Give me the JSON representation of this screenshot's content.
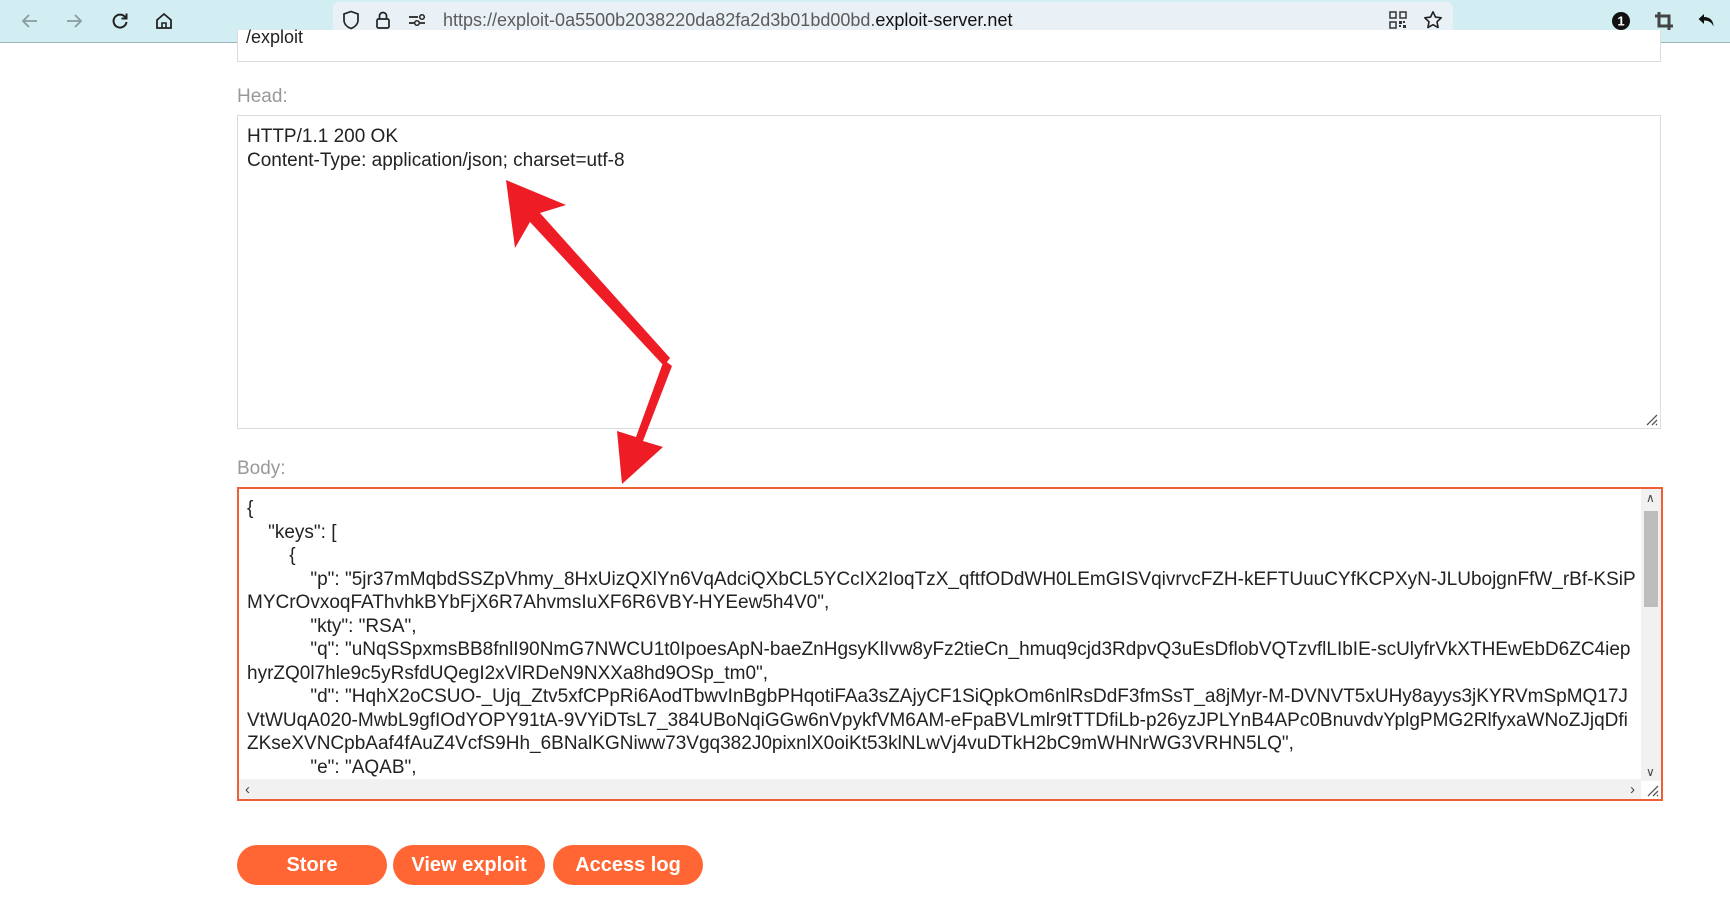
{
  "browser": {
    "url_prefix": "https://exploit-0a5500b2038220da82fa2d3b01bd00bd.",
    "url_domain": "exploit-server.net",
    "extension_badge": "1"
  },
  "form": {
    "file_value": "/exploit",
    "head_label": "Head:",
    "head_value": "HTTP/1.1 200 OK\nContent-Type: application/json; charset=utf-8",
    "body_label": "Body:",
    "body_value": "{\n    \"keys\": [\n        {\n            \"p\": \"5jr37mMqbdSSZpVhmy_8HxUizQXlYn6VqAdciQXbCL5YCcIX2IoqTzX_qftfODdWH0LEmGISVqivrvcFZH-kEFTUuuCYfKCPXyN-JLUbojgnFfW_rBf-KSiPMYCrOvxoqFAThvhkBYbFjX6R7AhvmsIuXF6R6VBY-HYEew5h4V0\",\n            \"kty\": \"RSA\",\n            \"q\": \"uNqSSpxmsBB8fnlI90NmG7NWCU1t0IpoesApN-baeZnHgsyKlIvw8yFz2tieCn_hmuq9cjd3RdpvQ3uEsDflobVQTzvflLIbIE-scUlyfrVkXTHEwEbD6ZC4iephyrZQ0l7hle9c5yRsfdUQegI2xVlRDeN9NXXa8hd9OSp_tm0\",\n            \"d\": \"HqhX2oCSUO-_Ujq_Ztv5xfCPpRi6AodTbwvInBgbPHqotiFAa3sZAjyCF1SiQpkOm6nlRsDdF3fmSsT_a8jMyr-M-DVNVT5xUHy8ayys3jKYRVmSpMQ17JVtWUqA020-MwbL9gfIOdYOPY91tA-9VYiDTsL7_384UBoNqiGGw6nVpykfVM6AM-eFpaBVLmlr9tTTDfiLb-p26yzJPLYnB4APc0BnuvdvYplgPMG2RlfyxaWNoZJjqDfiZKseXVNCpbAaf4fAuZ4VcfS9Hh_6BNalKGNiww73Vgq382J0pixnlX0oiKt53klNLwVj4vuDTkH2bC9mWHNrWG3VRHN5LQ\",\n            \"e\": \"AQAB\","
  },
  "buttons": {
    "store": "Store",
    "view_exploit": "View exploit",
    "access_log": "Access log"
  },
  "colors": {
    "accent": "#ff6633",
    "annotation_arrow": "#ee1c25"
  }
}
